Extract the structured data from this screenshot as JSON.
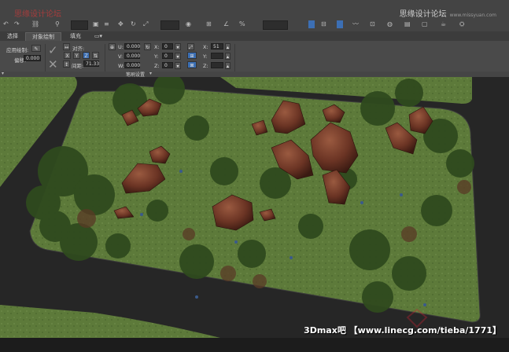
{
  "watermarks": {
    "left": "思缘设计论坛",
    "right": "思缘设计论坛",
    "right_url": "www.missyuan.com"
  },
  "tabs": [
    {
      "label": "选择"
    },
    {
      "label": "对象绘制"
    },
    {
      "label": "填充"
    }
  ],
  "ribbon": {
    "apply_label": "应用绘制:",
    "offset_label": "偏移:",
    "offset_value": "0.000",
    "align_label": "对齐:",
    "axes": [
      "X",
      "Y",
      "Z"
    ],
    "spacing_label": "间距:",
    "spacing_value": "71.33",
    "u_label": "U:",
    "u_value": "0.000",
    "v_label": "V:",
    "v_value": "0.000",
    "w_label": "W:",
    "w_value": "0.000",
    "x_label": "X:",
    "x_value": "0",
    "y_label": "Y:",
    "y_value": "0",
    "z_label": "Z:",
    "z_value": "0",
    "scale_x_label": "X:",
    "scale_x_value": "51",
    "scale_y_label": "Y:",
    "scale_z_label": "Z:",
    "panel_title": "笔刷设置"
  },
  "caption": "3Dmax吧 【www.linecg.com/tieba/1771】",
  "colors": {
    "grass": "#5e7a3a",
    "road": "#2b2b2b",
    "rock": "#6b3424",
    "ui_accent": "#3c6fb4"
  }
}
